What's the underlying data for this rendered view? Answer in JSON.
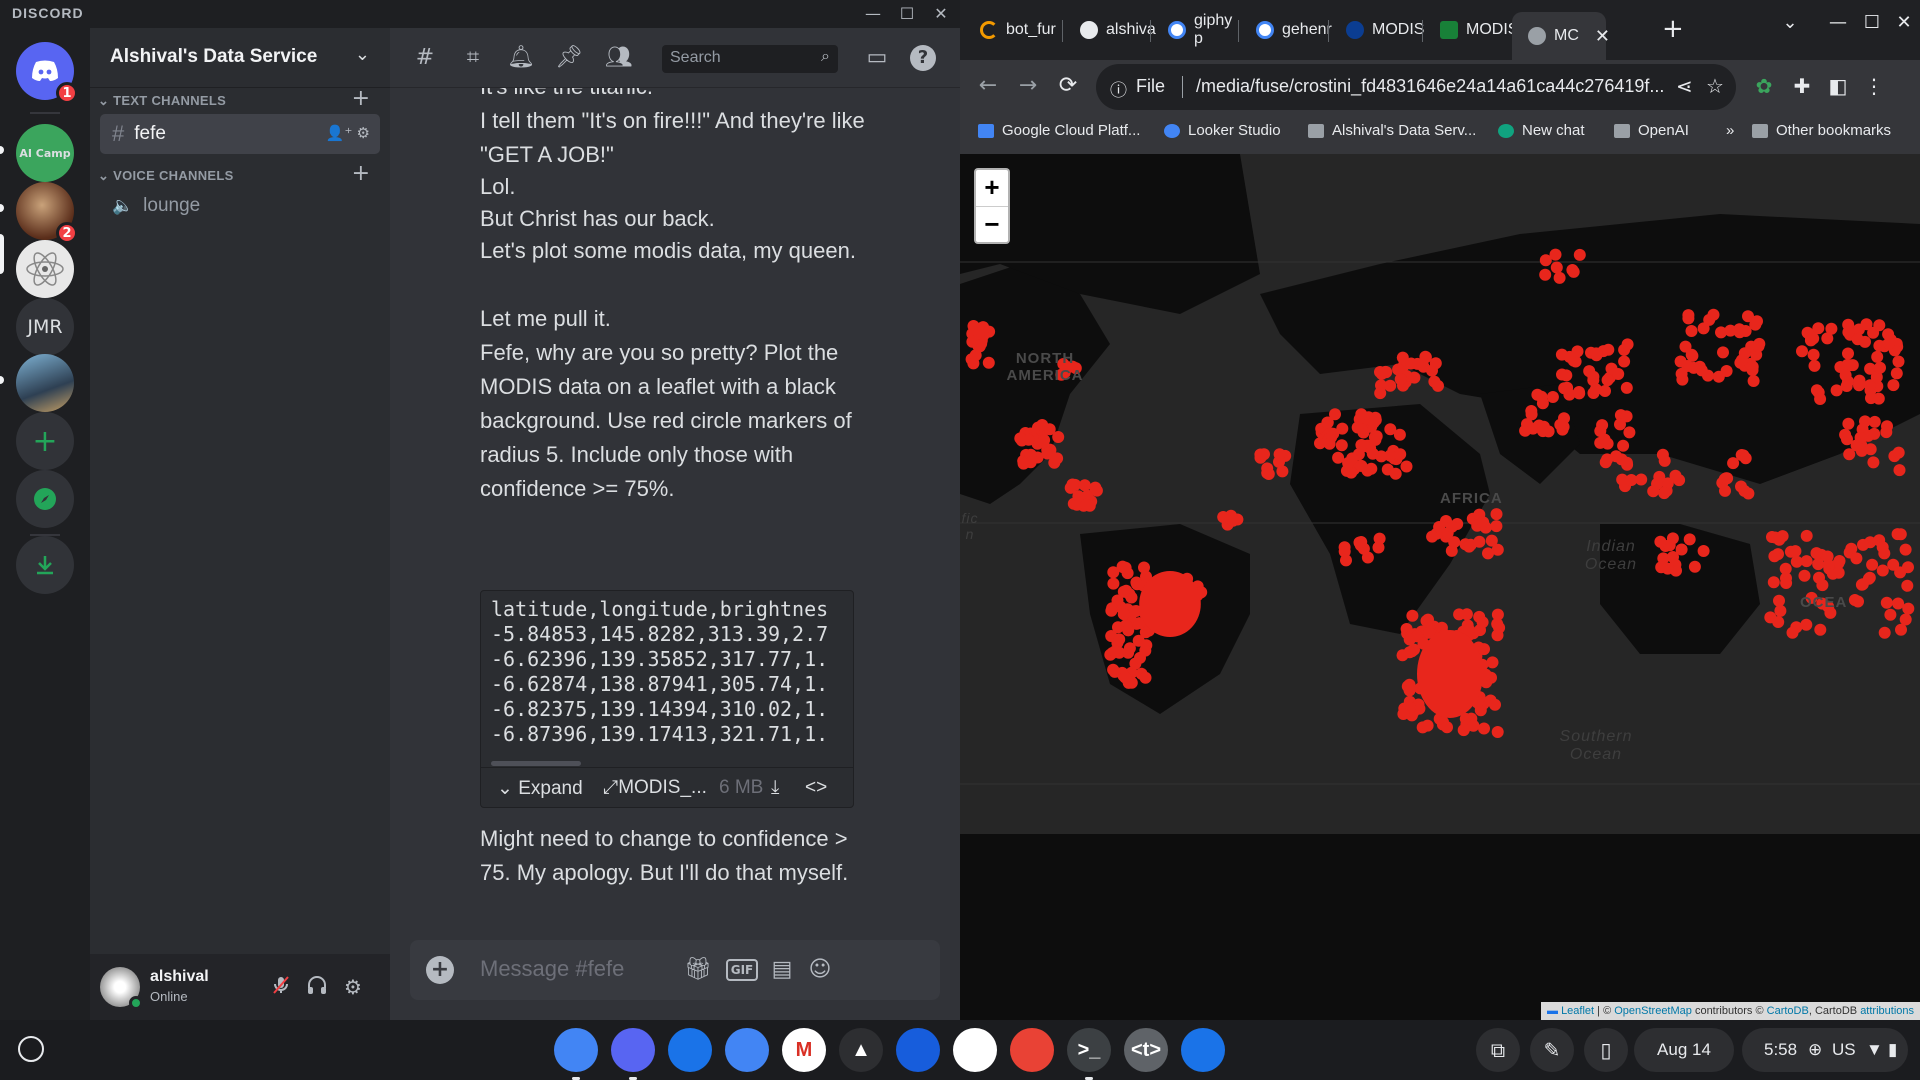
{
  "discord": {
    "wordmark": "DISCORD",
    "window_controls": {
      "minimize": "—",
      "maximize": "☐",
      "close": "✕"
    },
    "guilds": [
      {
        "name": "home",
        "badge": "1"
      },
      {
        "name": "AI Camp",
        "badge": ""
      },
      {
        "name": "server-2",
        "badge": "2"
      },
      {
        "name": "server-3",
        "badge": ""
      },
      {
        "name": "JMR",
        "badge": ""
      },
      {
        "name": "server-5",
        "badge": ""
      }
    ],
    "guild_jmr_label": "JMR",
    "guild_aicamp_label": "AI Camp",
    "server_name": "Alshival's Data Service",
    "categories": {
      "text": "TEXT CHANNELS",
      "voice": "VOICE CHANNELS"
    },
    "channels": {
      "text": [
        {
          "name": "fefe"
        }
      ],
      "voice": [
        {
          "name": "lounge"
        }
      ]
    },
    "user": {
      "name": "alshival",
      "status": "Online"
    },
    "header": {
      "search_placeholder": "Search"
    },
    "messages": [
      "It's like the titanic.",
      "I tell them \"It's on fire!!!\" And they're like \"GET A JOB!\"",
      "Lol.",
      "But Christ has our back.",
      "Let's plot some modis data, my queen.",
      "Let me pull it.",
      "Fefe, why are you so pretty? Plot the MODIS data on a leaflet with a black background. Use red circle markers of radius 5. Include only those with confidence >= 75%.",
      "Might need to change to confidence > 75. My apology. But I'll do that myself."
    ],
    "code_lines": [
      "latitude,longitude,brightnes",
      "-5.84853,145.8282,313.39,2.7",
      "-6.62396,139.35852,317.77,1.",
      "-6.62874,138.87941,305.74,1.",
      "-6.82375,139.14394,310.02,1.",
      "-6.87396,139.17413,321.71,1."
    ],
    "attachment": {
      "expand_label": "Expand",
      "filename": "MODIS_...",
      "size": "6 MB"
    },
    "composer_placeholder": "Message #fefe",
    "composer_gif": "GIF"
  },
  "chrome": {
    "tabs": [
      {
        "title": "bot_fur",
        "icon": "loading-icon",
        "color": "#f29900"
      },
      {
        "title": "alshiva",
        "icon": "github-icon",
        "color": "#e8eaed"
      },
      {
        "title": "giphy p",
        "icon": "google-icon",
        "color": "#4285f4"
      },
      {
        "title": "gehenr",
        "icon": "google-icon",
        "color": "#4285f4"
      },
      {
        "title": "MODIS",
        "icon": "nasa-icon",
        "color": "#0b3d91"
      },
      {
        "title": "MODIS",
        "icon": "sheets-icon",
        "color": "#188038"
      },
      {
        "title": "MC",
        "icon": "globe-icon",
        "color": "#9aa0a6"
      }
    ],
    "new_tab": "+",
    "window_controls": {
      "dropdown": "⌄",
      "minimize": "—",
      "maximize": "☐",
      "close": "✕"
    },
    "url_scheme": "File",
    "url": "/media/fuse/crostini_fd4831646e24a14a61ca44c276419f...",
    "bookmarks": [
      {
        "label": "Google Cloud Platf...",
        "icon": "gcp-icon"
      },
      {
        "label": "Looker Studio",
        "icon": "looker-icon"
      },
      {
        "label": "Alshival's Data Serv...",
        "icon": "folder-icon"
      },
      {
        "label": "New chat",
        "icon": "openai-icon"
      },
      {
        "label": "OpenAI",
        "icon": "folder-icon"
      }
    ],
    "bookmarks_more": "»",
    "other_bookmarks": "Other bookmarks",
    "map": {
      "zoom_in": "+",
      "zoom_out": "−",
      "labels": {
        "north_america": "NORTH AMERICA",
        "africa": "AFRICA",
        "indian_ocean": "Indian Ocean",
        "southern_ocean": "Southern Ocean",
        "oceania": "OCEA",
        "edge_text": "fic n"
      },
      "attribution": {
        "leaflet": "Leaflet",
        "sep1": " | © ",
        "osm": "OpenStreetMap",
        "mid": " contributors © ",
        "carto": "CartoDB",
        "mid2": ", CartoDB ",
        "attr": "attributions"
      },
      "marker_color": "#e8261c",
      "background": "#262626"
    }
  },
  "shelf": {
    "apps": [
      {
        "name": "chrome",
        "color": "#4285f4",
        "label": "",
        "running": true
      },
      {
        "name": "discord",
        "color": "#5865f2",
        "label": "",
        "running": true
      },
      {
        "name": "files",
        "color": "#1a73e8",
        "label": "",
        "running": false
      },
      {
        "name": "messages",
        "color": "#4285f4",
        "label": "",
        "running": false
      },
      {
        "name": "gmail",
        "color": "#ffffff",
        "label": "M",
        "running": false
      },
      {
        "name": "drive",
        "color": "#2d2e31",
        "label": "▲",
        "running": false
      },
      {
        "name": "bitwarden",
        "color": "#175ddc",
        "label": "",
        "running": false
      },
      {
        "name": "phone",
        "color": "#ffffff",
        "label": "",
        "running": false
      },
      {
        "name": "canvas",
        "color": "#e94235",
        "label": "",
        "running": false
      },
      {
        "name": "terminal",
        "color": "#3c4043",
        "label": ">_",
        "running": true
      },
      {
        "name": "text-editor",
        "color": "#5f6368",
        "label": "<t>",
        "running": false
      },
      {
        "name": "camera",
        "color": "#1a73e8",
        "label": "",
        "running": false
      }
    ],
    "date": "Aug 14",
    "time": "5:58",
    "locale": "US"
  }
}
